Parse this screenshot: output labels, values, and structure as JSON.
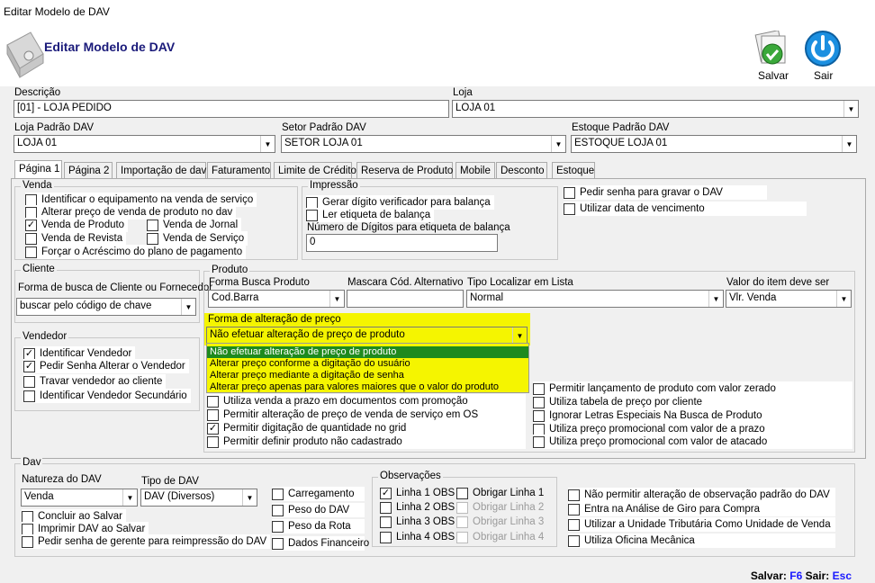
{
  "window": {
    "title": "Editar Modelo de DAV"
  },
  "header": {
    "title": "Editar Modelo de DAV",
    "save_label": "Salvar",
    "exit_label": "Sair"
  },
  "top": {
    "descricao_label": "Descrição",
    "descricao_value": "[01] - LOJA PEDIDO",
    "loja_label": "Loja",
    "loja_value": "LOJA 01",
    "loja_padrao_label": "Loja Padrão DAV",
    "loja_padrao_value": "LOJA 01",
    "setor_label": "Setor Padrão DAV",
    "setor_value": "SETOR LOJA 01",
    "estoque_label": "Estoque Padrão DAV",
    "estoque_value": "ESTOQUE LOJA 01"
  },
  "tabs": [
    "Página 1",
    "Página 2",
    "Importação de dav",
    "Faturamento",
    "Limite de Crédito",
    "Reserva de Produto",
    "Mobile",
    "Desconto",
    "Estoque"
  ],
  "venda": {
    "legend": "Venda",
    "items": [
      {
        "label": "Identificar o equipamento na venda de serviço",
        "checked": false
      },
      {
        "label": "Alterar preço de venda de produto no dav",
        "checked": false
      },
      {
        "label": "Venda de Produto",
        "checked": true
      },
      {
        "label": "Venda de Jornal",
        "checked": false
      },
      {
        "label": "Venda de Revista",
        "checked": false
      },
      {
        "label": "Venda de Serviço",
        "checked": false
      },
      {
        "label": "Forçar o Acréscimo do plano de pagamento",
        "checked": false
      }
    ]
  },
  "impressao": {
    "legend": "Impressão",
    "items": [
      {
        "label": "Gerar dígito verificador para balança",
        "checked": false
      },
      {
        "label": "Ler etiqueta de balança",
        "checked": false
      }
    ],
    "digitos_label": "Número de Dígitos para etiqueta de balança",
    "digitos_value": "0"
  },
  "right_top": [
    {
      "label": "Pedir senha para gravar o DAV",
      "checked": false
    },
    {
      "label": "Utilizar data de vencimento",
      "checked": false
    }
  ],
  "cliente": {
    "legend": "Cliente",
    "busca_label": "Forma de busca de Cliente ou Fornecedor",
    "busca_value": "buscar pelo código de chave"
  },
  "vendedor": {
    "legend": "Vendedor",
    "items": [
      {
        "label": "Identificar Vendedor",
        "checked": true
      },
      {
        "label": "Pedir Senha Alterar o Vendedor",
        "checked": true
      },
      {
        "label": "Travar vendedor ao cliente",
        "checked": false
      },
      {
        "label": "Identificar Vendedor Secundário",
        "checked": false
      }
    ]
  },
  "produto": {
    "legend": "Produto",
    "forma_busca_label": "Forma Busca Produto",
    "forma_busca_value": "Cod.Barra",
    "mascara_label": "Mascara Cód. Alternativo",
    "mascara_value": "",
    "tipo_localizar_label": "Tipo Localizar em Lista",
    "tipo_localizar_value": "Normal",
    "valor_item_label": "Valor do item deve ser",
    "valor_item_value": "Vlr. Venda",
    "alteracao_label": "Forma de alteração de preço",
    "alteracao_value": "Não efetuar alteração de preço de produto",
    "alteracao_options": [
      "Não efetuar alteração de preço de produto",
      "Alterar preço conforme a digitação do usuário",
      "Alterar preço mediante a digitação de senha",
      "Alterar preço apenas para valores maiores que o valor do produto"
    ],
    "left_items": [
      {
        "label": "Utiliza venda a prazo em documentos com promoção",
        "checked": false
      },
      {
        "label": "Permitir alteração de preço de venda  de serviço em OS",
        "checked": false
      },
      {
        "label": "Permitir digitação de quantidade no grid",
        "checked": true
      },
      {
        "label": "Permitir definir produto não cadastrado",
        "checked": false
      }
    ],
    "right_items": [
      {
        "label": "Permitir lançamento de produto com valor zerado",
        "checked": false
      },
      {
        "label": "Utiliza tabela de preço por cliente",
        "checked": false
      },
      {
        "label": "Ignorar Letras Especiais Na Busca de Produto",
        "checked": false
      },
      {
        "label": "Utiliza preço promocional com valor de a prazo",
        "checked": false
      },
      {
        "label": "Utiliza preço promocional com valor de atacado",
        "checked": false
      }
    ]
  },
  "dav": {
    "legend": "Dav",
    "natureza_label": "Natureza do DAV",
    "natureza_value": "Venda",
    "tipo_label": "Tipo de DAV",
    "tipo_value": "DAV (Diversos)",
    "left_items": [
      {
        "label": "Concluir ao Salvar",
        "checked": false
      },
      {
        "label": "Imprimir DAV ao Salvar",
        "checked": false
      },
      {
        "label": "Pedir senha de gerente para reimpressão do DAV",
        "checked": false
      }
    ],
    "mid_items": [
      {
        "label": "Carregamento",
        "checked": false
      },
      {
        "label": "Peso do DAV",
        "checked": false
      },
      {
        "label": "Peso da Rota",
        "checked": false
      },
      {
        "label": "Dados Financeiro",
        "checked": false
      }
    ],
    "obs_legend": "Observações",
    "obs_items": [
      {
        "label": "Linha 1 OBS",
        "checked": true,
        "obrig": "Obrigar Linha 1",
        "obrig_enabled": true
      },
      {
        "label": "Linha 2 OBS",
        "checked": false,
        "obrig": "Obrigar Linha 2",
        "obrig_enabled": false
      },
      {
        "label": "Linha 3 OBS",
        "checked": false,
        "obrig": "Obrigar Linha 3",
        "obrig_enabled": false
      },
      {
        "label": "Linha 4 OBS",
        "checked": false,
        "obrig": "Obrigar Linha 4",
        "obrig_enabled": false
      }
    ],
    "right_items": [
      {
        "label": "Não permitir alteração de observação padrão do DAV",
        "checked": false
      },
      {
        "label": "Entra na Análise de Giro para Compra",
        "checked": false
      },
      {
        "label": "Utilizar a Unidade Tributária Como Unidade de Venda",
        "checked": false
      },
      {
        "label": "Utiliza Oficina Mecânica",
        "checked": false
      }
    ]
  },
  "statusbar": {
    "salvar": "Salvar:",
    "salvar_key": "F6",
    "sair": "Sair:",
    "sair_key": "Esc"
  }
}
